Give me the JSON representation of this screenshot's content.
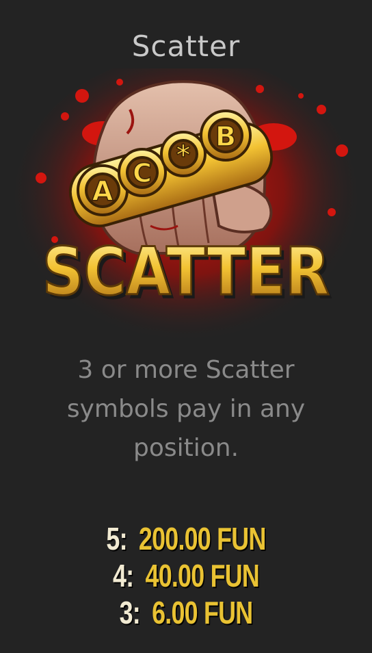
{
  "title": "Scatter",
  "symbol": {
    "icon": "scatter-fist-symbol-icon",
    "ring_letters": [
      "A",
      "C",
      "*",
      "B"
    ],
    "banner_text": "SCATTER",
    "colors": {
      "blood_red": "#c8140e",
      "gold": "#f2c233",
      "gold_dark": "#8a5a12",
      "skin": "#caa38d"
    }
  },
  "description": "3 or more Scatter symbols pay in any position.",
  "paytable": [
    {
      "count": "5:",
      "value": "200.00 FUN"
    },
    {
      "count": "4:",
      "value": "40.00 FUN"
    },
    {
      "count": "3:",
      "value": "6.00 FUN"
    }
  ]
}
